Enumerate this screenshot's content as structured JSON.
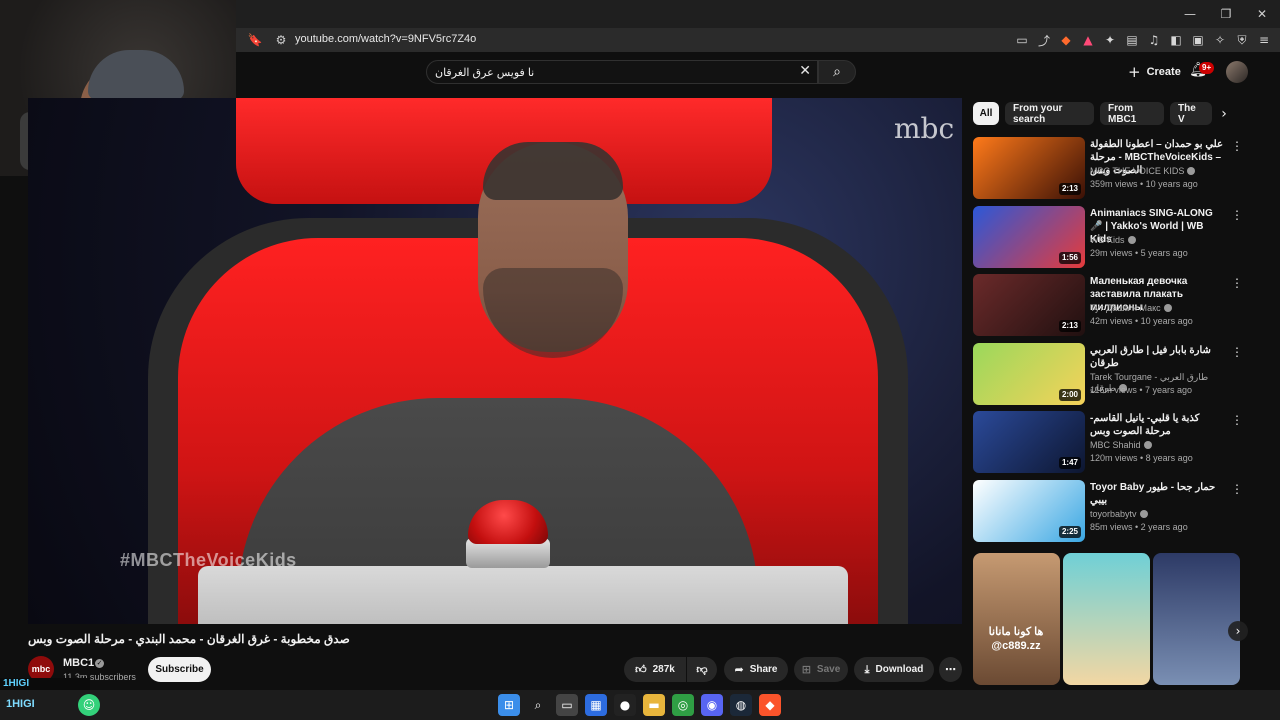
{
  "browser": {
    "url": "youtube.com/watch?v=9NFV5rc7Z4o",
    "window_controls": [
      "minimize",
      "maximize",
      "close"
    ]
  },
  "header": {
    "search_query": "نا فويس عرق الغرقان",
    "create_label": "Create",
    "notification_count": "9+"
  },
  "video": {
    "watermark": "#MBCTheVoiceKids",
    "channel_logo": "mbc",
    "title": "صدق مخطوبة - غرق الغرقان - محمد البندي - مرحلة الصوت وبس",
    "channel": {
      "name": "MBC1",
      "subscribers": "11.3m subscribers",
      "avatar_text": "mbc"
    },
    "subscribe_label": "Subscribe",
    "actions": {
      "likes": "287k",
      "share": "Share",
      "save": "Save",
      "download": "Download"
    }
  },
  "chips": [
    "All",
    "From your search",
    "From MBC1",
    "The V"
  ],
  "recommendations": [
    {
      "title": "علي بو حمدان – اعطونا الطفولة - مرحلة MBCTheVoiceKids – الصوت وبس",
      "channel": "MBC THE VOICE KIDS",
      "meta": "359m views • 10 years ago",
      "duration": "2:13",
      "colors": [
        "#ff7a1a",
        "#3a1006"
      ]
    },
    {
      "title": "Animaniacs SING-ALONG 🎤 | Yakko's World | WB Kids",
      "channel": "WB Kids",
      "meta": "29m views • 5 years ago",
      "duration": "1:56",
      "colors": [
        "#2b58d8",
        "#e63b3b"
      ]
    },
    {
      "title": "Маленькая девочка заставила плакать миллионы",
      "channel": "Тут Даша и Макс",
      "meta": "42m views • 10 years ago",
      "duration": "2:13",
      "colors": [
        "#6b2a2a",
        "#201010"
      ]
    },
    {
      "title": "شارة بابار فيل | طارق العربي طرقان",
      "channel": "Tarek Tourgane - طارق العربي طرقان",
      "meta": "116m views • 7 years ago",
      "duration": "2:00",
      "colors": [
        "#9ad85b",
        "#f5d25a"
      ]
    },
    {
      "title": "كذبة يا قلبي- يانيل القاسم- مرحلة الصوت وبس",
      "channel": "MBC Shahid",
      "meta": "120m views • 8 years ago",
      "duration": "1:47",
      "colors": [
        "#2b4a9a",
        "#0d1630"
      ]
    },
    {
      "title": "Toyor Baby حمار جحا - طيور بيبي",
      "channel": "toyorbabytv",
      "meta": "85m views • 2 years ago",
      "duration": "2:25",
      "colors": [
        "#ffffff",
        "#3aa7e3"
      ]
    }
  ],
  "shorts": [
    {
      "caption": "ها كونا مانانا @c889.zz",
      "colors": [
        "#c69a72",
        "#6b4a33"
      ]
    },
    {
      "caption": "",
      "colors": [
        "#6fd0d6",
        "#f2d7a3"
      ]
    },
    {
      "caption": "",
      "colors": [
        "#2d3a66",
        "#7a8fb3"
      ]
    }
  ],
  "overlay": {
    "stream_tag": "1HIGI"
  },
  "taskbar": {
    "left_text": "1HIGI"
  }
}
